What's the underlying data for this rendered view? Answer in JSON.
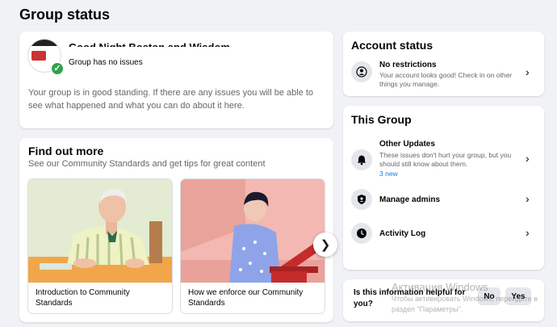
{
  "page": {
    "title": "Group status"
  },
  "group": {
    "name": "Good Night Boston and Wisdom",
    "status": "Group has no issues",
    "description": "Your group is in good standing. If there are any issues you will be able to see what happened and what you can do about it here."
  },
  "find_out_more": {
    "title": "Find out more",
    "subtitle": "See our Community Standards and get tips for great content",
    "tiles": [
      {
        "caption": "Introduction to Community Standards"
      },
      {
        "caption": "How we enforce our Community Standards"
      }
    ]
  },
  "account_status": {
    "title": "Account status",
    "row": {
      "title": "No restrictions",
      "description": "Your account looks good! Check in on other things you manage."
    }
  },
  "this_group": {
    "title": "This Group",
    "rows": [
      {
        "title": "Other Updates",
        "description": "These issues don't hurt your group, but you should still know about them.",
        "badge": "3 new"
      },
      {
        "title": "Manage admins"
      },
      {
        "title": "Activity Log"
      }
    ]
  },
  "feedback": {
    "question": "Is this information helpful for you?",
    "no_label": "No",
    "yes_label": "Yes"
  },
  "watermark": {
    "line1": "Активация Windows",
    "line2": "Чтобы активировать Windows, перейдите в раздел \"Параметры\"."
  },
  "colors": {
    "success": "#31a24c",
    "link": "#1877f2",
    "background": "#f0f2f5"
  }
}
